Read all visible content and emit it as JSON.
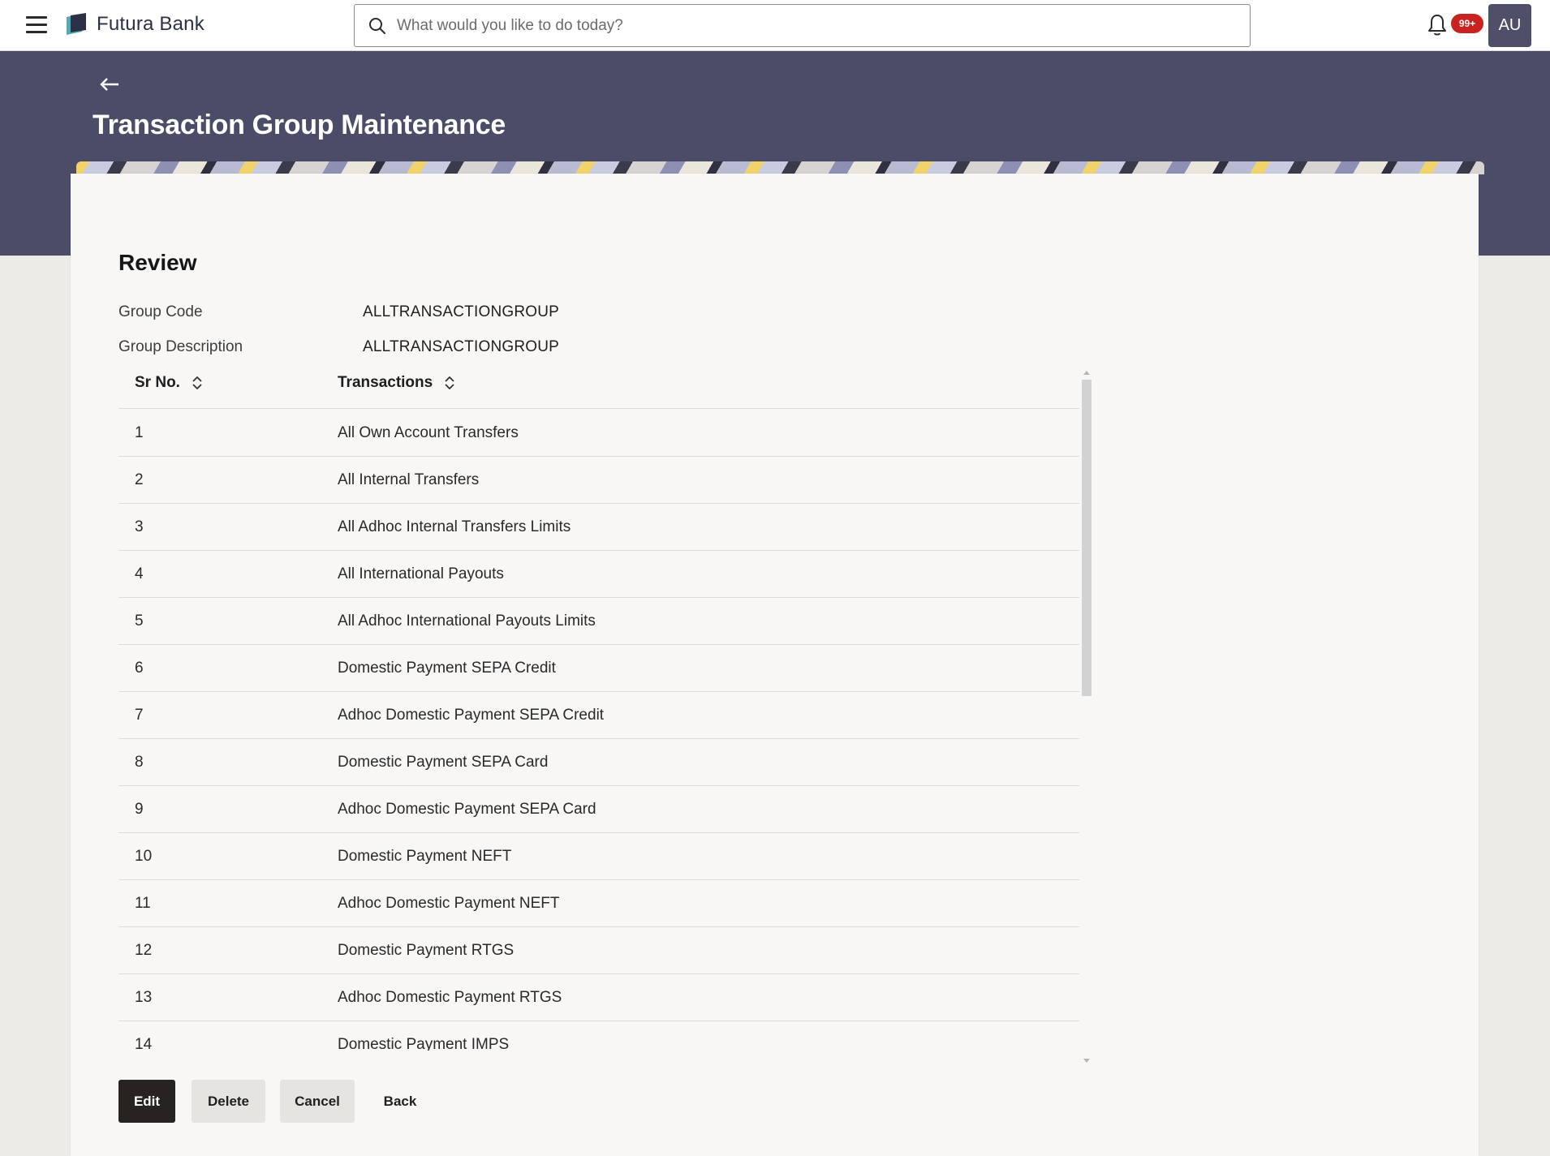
{
  "header": {
    "brand_name": "Futura Bank",
    "search_placeholder": "What would you like to do today?",
    "notification_count": "99+",
    "user_initials": "AU"
  },
  "page": {
    "title": "Transaction Group Maintenance"
  },
  "review": {
    "title": "Review",
    "fields": [
      {
        "label": "Group Code",
        "value": "ALLTRANSACTIONGROUP"
      },
      {
        "label": "Group Description",
        "value": "ALLTRANSACTIONGROUP"
      }
    ]
  },
  "table": {
    "columns": [
      "Sr No.",
      "Transactions"
    ],
    "rows": [
      {
        "sr": "1",
        "transaction": "All Own Account Transfers"
      },
      {
        "sr": "2",
        "transaction": "All Internal Transfers"
      },
      {
        "sr": "3",
        "transaction": "All Adhoc Internal Transfers Limits"
      },
      {
        "sr": "4",
        "transaction": "All International Payouts"
      },
      {
        "sr": "5",
        "transaction": "All Adhoc International Payouts Limits"
      },
      {
        "sr": "6",
        "transaction": "Domestic Payment SEPA Credit"
      },
      {
        "sr": "7",
        "transaction": "Adhoc Domestic Payment SEPA Credit"
      },
      {
        "sr": "8",
        "transaction": "Domestic Payment SEPA Card"
      },
      {
        "sr": "9",
        "transaction": "Adhoc Domestic Payment SEPA Card"
      },
      {
        "sr": "10",
        "transaction": "Domestic Payment NEFT"
      },
      {
        "sr": "11",
        "transaction": "Adhoc Domestic Payment NEFT"
      },
      {
        "sr": "12",
        "transaction": "Domestic Payment RTGS"
      },
      {
        "sr": "13",
        "transaction": "Adhoc Domestic Payment RTGS"
      },
      {
        "sr": "14",
        "transaction": "Domestic Payment IMPS"
      }
    ]
  },
  "actions": {
    "edit": "Edit",
    "delete": "Delete",
    "cancel": "Cancel",
    "back": "Back"
  },
  "colors": {
    "banner": "#4a4c68",
    "primary_button": "#262321",
    "badge": "#c8231f",
    "avatar": "#4d5068"
  },
  "icons": {
    "menu": "hamburger-menu-icon",
    "brand": "futura-bank-logo-icon",
    "search": "search-icon",
    "notifications": "bell-icon",
    "back": "back-arrow-icon",
    "sort": "sort-icon"
  }
}
